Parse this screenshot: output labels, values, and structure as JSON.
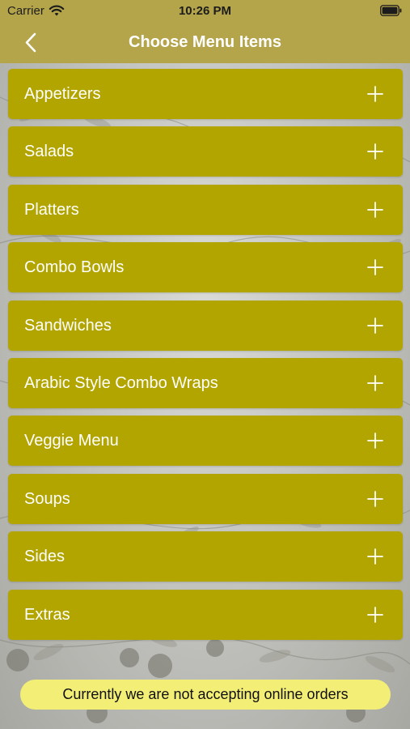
{
  "status_bar": {
    "carrier": "Carrier",
    "time": "10:26 PM",
    "wifi_icon": "wifi-icon",
    "battery_icon": "battery-icon"
  },
  "nav": {
    "title": "Choose Menu Items",
    "back_icon": "chevron-left-icon"
  },
  "menu": {
    "items": [
      {
        "label": "Appetizers",
        "icon": "plus-icon"
      },
      {
        "label": "Salads",
        "icon": "plus-icon"
      },
      {
        "label": "Platters",
        "icon": "plus-icon"
      },
      {
        "label": "Combo Bowls",
        "icon": "plus-icon"
      },
      {
        "label": "Sandwiches",
        "icon": "plus-icon"
      },
      {
        "label": "Arabic Style Combo Wraps",
        "icon": "plus-icon"
      },
      {
        "label": "Veggie Menu",
        "icon": "plus-icon"
      },
      {
        "label": "Soups",
        "icon": "plus-icon"
      },
      {
        "label": "Sides",
        "icon": "plus-icon"
      },
      {
        "label": "Extras",
        "icon": "plus-icon"
      }
    ]
  },
  "notice": {
    "text": "Currently we are not accepting online orders"
  },
  "colors": {
    "bar": "#b5a54a",
    "menu_item": "#b3a500",
    "notice_bg": "#f3ee75",
    "text_light": "#ffffff"
  }
}
